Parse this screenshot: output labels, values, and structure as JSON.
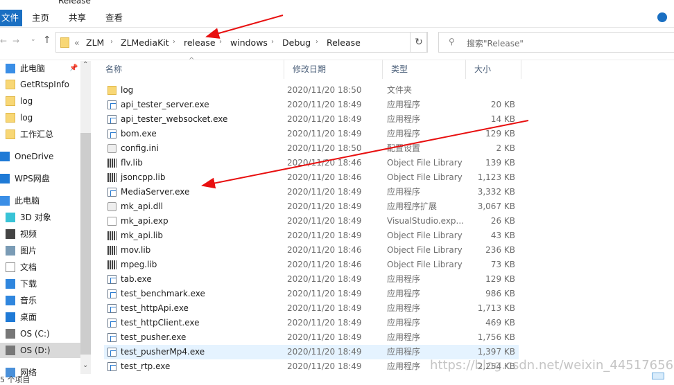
{
  "window": {
    "title": "Release"
  },
  "ribbon": {
    "tabs": [
      "文件",
      "主页",
      "共享",
      "查看"
    ]
  },
  "address": {
    "overflow": "«",
    "crumbs": [
      "ZLM",
      "ZLMediaKit",
      "release",
      "windows",
      "Debug",
      "Release"
    ]
  },
  "search": {
    "placeholder": "搜索\"Release\""
  },
  "sidebar": {
    "items": [
      {
        "label": "此电脑",
        "icon": "computer-icon",
        "pinned": true
      },
      {
        "label": "GetRtspInfo",
        "icon": "folder-icon"
      },
      {
        "label": "log",
        "icon": "folder-icon"
      },
      {
        "label": "log",
        "icon": "folder-icon"
      },
      {
        "label": "工作汇总",
        "icon": "folder-icon"
      },
      {
        "label": "OneDrive",
        "icon": "cloud-icon"
      },
      {
        "label": "WPS网盘",
        "icon": "cloud-icon"
      },
      {
        "label": "此电脑",
        "icon": "computer-icon"
      },
      {
        "label": "3D 对象",
        "icon": "cube-icon"
      },
      {
        "label": "视频",
        "icon": "video-icon"
      },
      {
        "label": "图片",
        "icon": "picture-icon"
      },
      {
        "label": "文档",
        "icon": "document-icon"
      },
      {
        "label": "下载",
        "icon": "download-icon"
      },
      {
        "label": "音乐",
        "icon": "music-icon"
      },
      {
        "label": "桌面",
        "icon": "desktop-icon"
      },
      {
        "label": "OS (C:)",
        "icon": "drive-icon"
      },
      {
        "label": "OS (D:)",
        "icon": "drive-icon",
        "selected": true
      },
      {
        "label": "网络",
        "icon": "network-icon"
      }
    ]
  },
  "columns": {
    "name": "名称",
    "date": "修改日期",
    "type": "类型",
    "size": "大小"
  },
  "files": [
    {
      "name": "log",
      "date": "2020/11/20 18:50",
      "type": "文件夹",
      "size": "",
      "icon": "folder"
    },
    {
      "name": "api_tester_server.exe",
      "date": "2020/11/20 18:49",
      "type": "应用程序",
      "size": "20 KB",
      "icon": "exe"
    },
    {
      "name": "api_tester_websocket.exe",
      "date": "2020/11/20 18:49",
      "type": "应用程序",
      "size": "14 KB",
      "icon": "exe"
    },
    {
      "name": "bom.exe",
      "date": "2020/11/20 18:49",
      "type": "应用程序",
      "size": "129 KB",
      "icon": "exe"
    },
    {
      "name": "config.ini",
      "date": "2020/11/20 18:50",
      "type": "配置设置",
      "size": "2 KB",
      "icon": "cfg"
    },
    {
      "name": "flv.lib",
      "date": "2020/11/20 18:46",
      "type": "Object File Library",
      "size": "139 KB",
      "icon": "lib"
    },
    {
      "name": "jsoncpp.lib",
      "date": "2020/11/20 18:46",
      "type": "Object File Library",
      "size": "1,123 KB",
      "icon": "lib"
    },
    {
      "name": "MediaServer.exe",
      "date": "2020/11/20 18:49",
      "type": "应用程序",
      "size": "3,332 KB",
      "icon": "exe"
    },
    {
      "name": "mk_api.dll",
      "date": "2020/11/20 18:49",
      "type": "应用程序扩展",
      "size": "3,067 KB",
      "icon": "cfg"
    },
    {
      "name": "mk_api.exp",
      "date": "2020/11/20 18:49",
      "type": "VisualStudio.exp...",
      "size": "26 KB",
      "icon": "doc"
    },
    {
      "name": "mk_api.lib",
      "date": "2020/11/20 18:49",
      "type": "Object File Library",
      "size": "43 KB",
      "icon": "lib"
    },
    {
      "name": "mov.lib",
      "date": "2020/11/20 18:46",
      "type": "Object File Library",
      "size": "236 KB",
      "icon": "lib"
    },
    {
      "name": "mpeg.lib",
      "date": "2020/11/20 18:46",
      "type": "Object File Library",
      "size": "73 KB",
      "icon": "lib"
    },
    {
      "name": "tab.exe",
      "date": "2020/11/20 18:49",
      "type": "应用程序",
      "size": "129 KB",
      "icon": "exe"
    },
    {
      "name": "test_benchmark.exe",
      "date": "2020/11/20 18:49",
      "type": "应用程序",
      "size": "986 KB",
      "icon": "exe"
    },
    {
      "name": "test_httpApi.exe",
      "date": "2020/11/20 18:49",
      "type": "应用程序",
      "size": "1,713 KB",
      "icon": "exe"
    },
    {
      "name": "test_httpClient.exe",
      "date": "2020/11/20 18:49",
      "type": "应用程序",
      "size": "469 KB",
      "icon": "exe"
    },
    {
      "name": "test_pusher.exe",
      "date": "2020/11/20 18:49",
      "type": "应用程序",
      "size": "1,756 KB",
      "icon": "exe"
    },
    {
      "name": "test_pusherMp4.exe",
      "date": "2020/11/20 18:49",
      "type": "应用程序",
      "size": "1,397 KB",
      "icon": "exe",
      "selected": true
    },
    {
      "name": "test_rtp.exe",
      "date": "2020/11/20 18:49",
      "type": "应用程序",
      "size": "2,254 KB",
      "icon": "exe"
    }
  ],
  "status": {
    "text": "5 个项目"
  },
  "watermark": "https://blog.csdn.net/weixin_44517656",
  "colors": {
    "accent": "#1a6fc2",
    "selection": "#e5f3ff",
    "annotation": "#e81010"
  }
}
